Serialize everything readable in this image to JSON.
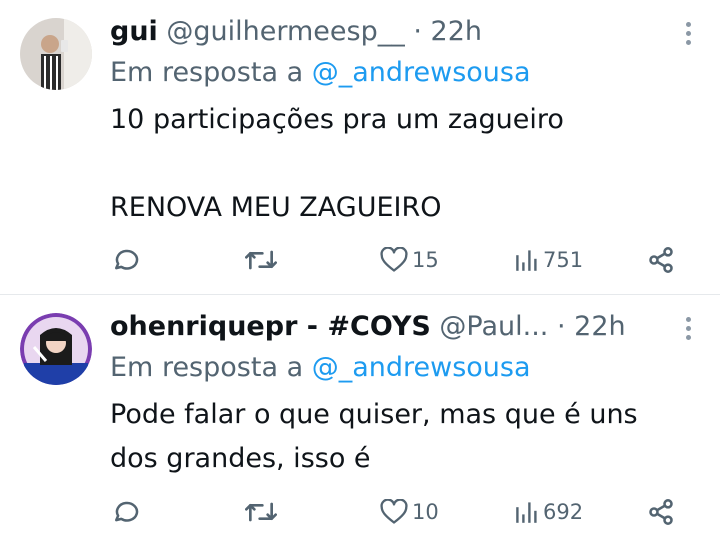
{
  "tweets": [
    {
      "name": "gui",
      "handle": "@guilhermeesp__",
      "separator": "·",
      "time": "22h",
      "reply_prefix": "Em resposta a",
      "reply_to": "@_andrewsousa",
      "body": [
        "10 participações pra um zagueiro",
        "RENOVA MEU ZAGUEIRO"
      ],
      "stats": {
        "replies": "",
        "retweets": "",
        "likes": "15",
        "views": "751"
      },
      "icons": [
        "reply-icon",
        "retweet-icon",
        "like-icon",
        "views-icon",
        "share-icon",
        "more-icon"
      ]
    },
    {
      "name": "ohenriquepr - #COYS",
      "handle": "@Paul...",
      "separator": "·",
      "time": "22h",
      "reply_prefix": "Em resposta a",
      "reply_to": "@_andrewsousa",
      "body": [
        "Pode falar o que quiser, mas que é uns",
        "dos grandes, isso é"
      ],
      "stats": {
        "replies": "",
        "retweets": "",
        "likes": "10",
        "views": "692"
      },
      "icons": [
        "reply-icon",
        "retweet-icon",
        "like-icon",
        "views-icon",
        "share-icon",
        "more-icon"
      ]
    }
  ],
  "colors": {
    "text": "#0f1419",
    "secondary": "#536471",
    "link": "#1d9bf0",
    "divider": "#e6e9ec"
  }
}
